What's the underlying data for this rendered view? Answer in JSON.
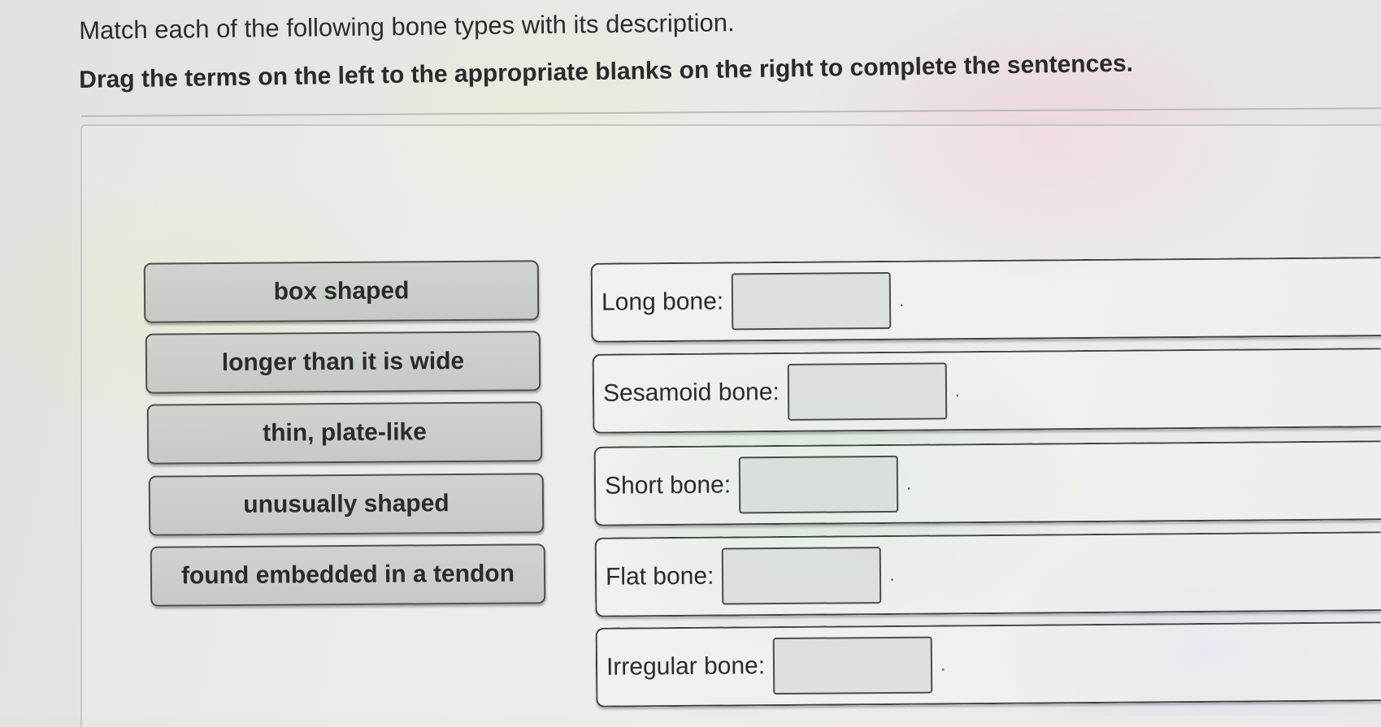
{
  "instruction": "Match each of the following bone types with its description.",
  "subinstruction": "Drag the terms on the left to the appropriate blanks on the right to complete the sentences.",
  "terms": [
    "box shaped",
    "longer than it is wide",
    "thin, plate-like",
    "unusually shaped",
    "found embedded in a tendon"
  ],
  "sentences": [
    {
      "label": "Long bone",
      "colon": ":",
      "blank_value": "",
      "period": "."
    },
    {
      "label": "Sesamoid bone",
      "colon": ":",
      "blank_value": "",
      "period": "."
    },
    {
      "label": "Short bone",
      "colon": ":",
      "blank_value": "",
      "period": "."
    },
    {
      "label": "Flat bone",
      "colon": ":",
      "blank_value": "",
      "period": "."
    },
    {
      "label": "Irregular bone",
      "colon": ":",
      "blank_value": "",
      "period": "."
    }
  ]
}
